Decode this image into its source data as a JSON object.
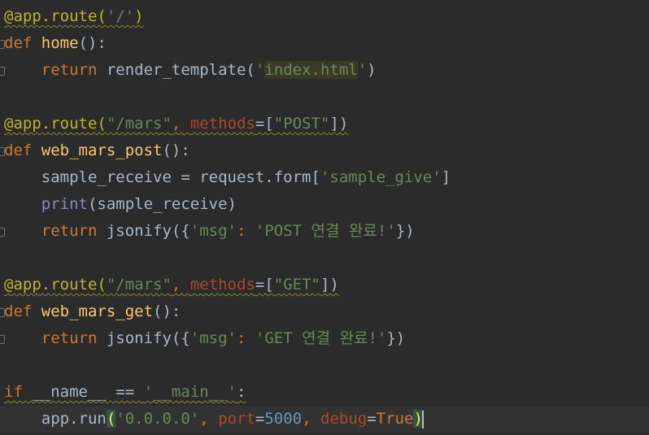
{
  "editor": {
    "language": "python",
    "lines": [
      [
        {
          "t": "@app.route(",
          "c": "d wv"
        },
        {
          "t": "'/'",
          "c": "s wv"
        },
        {
          "t": ")",
          "c": "d wv"
        }
      ],
      [
        {
          "t": "def ",
          "c": "k"
        },
        {
          "t": "home",
          "c": "f"
        },
        {
          "t": "():",
          "c": "t"
        }
      ],
      [
        {
          "t": "    "
        },
        {
          "t": "return ",
          "c": "k"
        },
        {
          "t": "render_template(",
          "c": "t"
        },
        {
          "t": "'",
          "c": "s"
        },
        {
          "t": "index.html",
          "c": "s hl"
        },
        {
          "t": "'",
          "c": "s"
        },
        {
          "t": ")",
          "c": "t"
        }
      ],
      [],
      [
        {
          "t": "@app.route(",
          "c": "d wv"
        },
        {
          "t": "\"/mars\"",
          "c": "s wv"
        },
        {
          "t": ", ",
          "c": "k wv"
        },
        {
          "t": "methods",
          "c": "p wv"
        },
        {
          "t": "=[",
          "c": "t wv"
        },
        {
          "t": "\"POST\"",
          "c": "s wv"
        },
        {
          "t": "])",
          "c": "t wv"
        }
      ],
      [
        {
          "t": "def ",
          "c": "k"
        },
        {
          "t": "web_mars_post",
          "c": "f"
        },
        {
          "t": "():",
          "c": "t"
        }
      ],
      [
        {
          "t": "    sample_receive = request.form[",
          "c": "t"
        },
        {
          "t": "'sample_give'",
          "c": "s"
        },
        {
          "t": "]",
          "c": "t"
        }
      ],
      [
        {
          "t": "    "
        },
        {
          "t": "print",
          "c": "b"
        },
        {
          "t": "(sample_receive)",
          "c": "t"
        }
      ],
      [
        {
          "t": "    "
        },
        {
          "t": "return ",
          "c": "k"
        },
        {
          "t": "jsonify({",
          "c": "t"
        },
        {
          "t": "'msg'",
          "c": "s"
        },
        {
          "t": ": ",
          "c": "k"
        },
        {
          "t": "'POST 연결 완료!'",
          "c": "s"
        },
        {
          "t": "})",
          "c": "t"
        }
      ],
      [],
      [
        {
          "t": "@app.route(",
          "c": "d wv"
        },
        {
          "t": "\"/mars\"",
          "c": "s wv"
        },
        {
          "t": ", ",
          "c": "k wv"
        },
        {
          "t": "methods",
          "c": "p wv"
        },
        {
          "t": "=[",
          "c": "t wv"
        },
        {
          "t": "\"GET\"",
          "c": "s wv"
        },
        {
          "t": "])",
          "c": "t wv"
        }
      ],
      [
        {
          "t": "def ",
          "c": "k"
        },
        {
          "t": "web_mars_get",
          "c": "f"
        },
        {
          "t": "():",
          "c": "t"
        }
      ],
      [
        {
          "t": "    "
        },
        {
          "t": "return ",
          "c": "k"
        },
        {
          "t": "jsonify({",
          "c": "t"
        },
        {
          "t": "'msg'",
          "c": "s"
        },
        {
          "t": ": ",
          "c": "k"
        },
        {
          "t": "'GET 연결 완료!'",
          "c": "s"
        },
        {
          "t": "})",
          "c": "t"
        }
      ],
      [],
      [
        {
          "t": "if ",
          "c": "k wv"
        },
        {
          "t": "__name__ == ",
          "c": "t wv"
        },
        {
          "t": "'__main__'",
          "c": "s wv"
        },
        {
          "t": ":",
          "c": "t wv"
        }
      ],
      [
        {
          "t": "    app.run",
          "c": "t"
        },
        {
          "t": "(",
          "c": "br"
        },
        {
          "t": "'0.0.0.0'",
          "c": "s"
        },
        {
          "t": ", ",
          "c": "k"
        },
        {
          "t": "port",
          "c": "p"
        },
        {
          "t": "=",
          "c": "t"
        },
        {
          "t": "5000",
          "c": "n"
        },
        {
          "t": ", ",
          "c": "k"
        },
        {
          "t": "debug",
          "c": "p"
        },
        {
          "t": "=",
          "c": "t"
        },
        {
          "t": "True",
          "c": "k"
        },
        {
          "t": ")",
          "c": "br"
        }
      ]
    ]
  }
}
